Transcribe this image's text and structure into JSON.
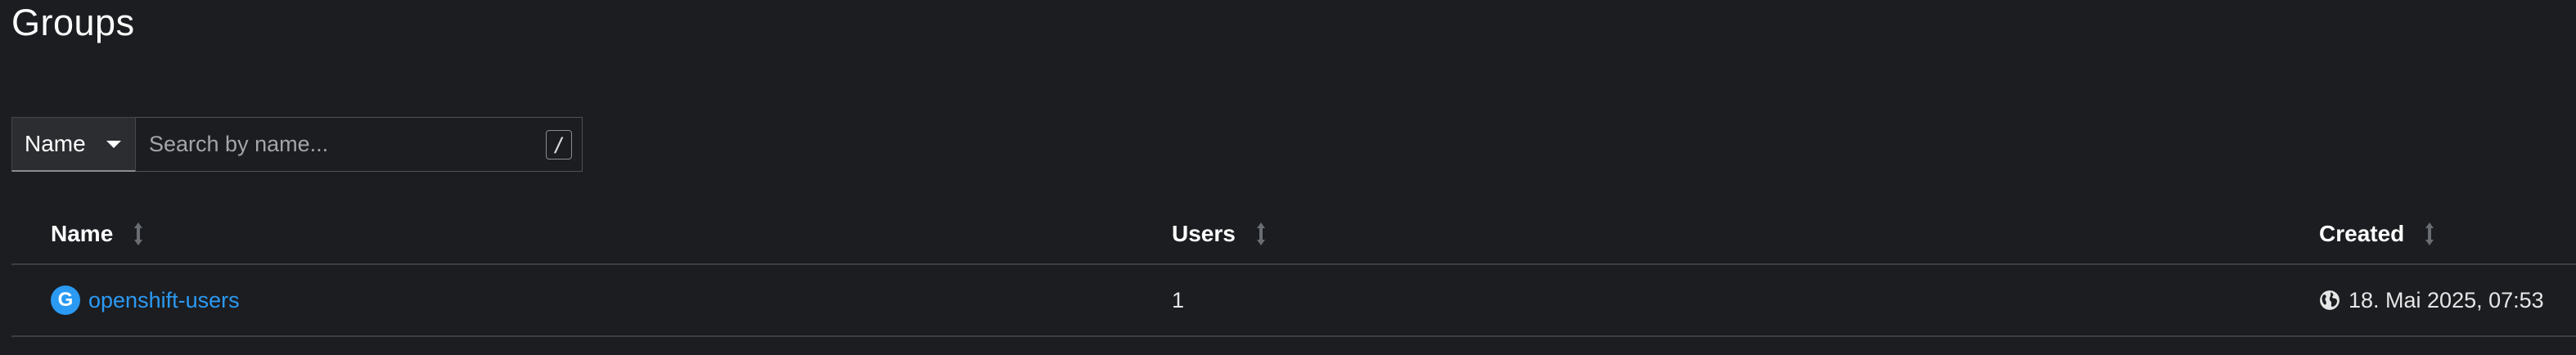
{
  "page": {
    "title": "Groups"
  },
  "filter": {
    "selected": "Name",
    "search_placeholder": "Search by name...",
    "shortcut_key": "/"
  },
  "table": {
    "columns": [
      {
        "label": "Name"
      },
      {
        "label": "Users"
      },
      {
        "label": "Created"
      }
    ],
    "rows": [
      {
        "badge": "G",
        "name": "openshift-users",
        "users": "1",
        "created": "18. Mai 2025, 07:53"
      }
    ]
  },
  "colors": {
    "accent": "#2b9af3",
    "background": "#1b1d21"
  },
  "icons": {
    "sort": "sort-icon",
    "globe": "globe-icon",
    "caret": "caret-down-icon"
  }
}
